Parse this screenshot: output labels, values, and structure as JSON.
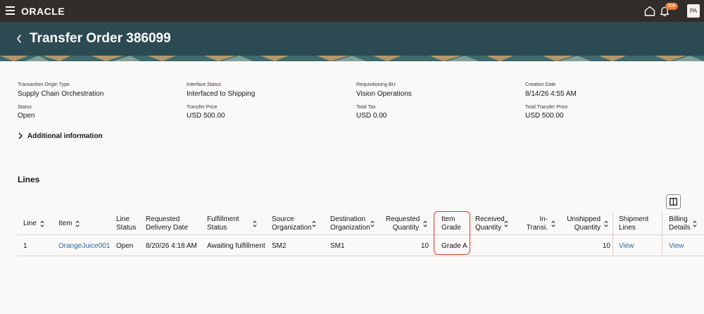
{
  "app": {
    "logo": "ORACLE",
    "notification_count": "306",
    "user_initials": "PA"
  },
  "header": {
    "title": "Transfer Order 386099"
  },
  "summary": {
    "transaction_origin_type_label": "Transaction Origin Type",
    "transaction_origin_type_value": "Supply Chain Orchestration",
    "interface_status_label": "Interface Status",
    "interface_status_value": "Interfaced to Shipping",
    "requisitioning_bu_label": "Requisitioning BU",
    "requisitioning_bu_value": "Vision Operations",
    "creation_date_label": "Creation Date",
    "creation_date_value": "8/14/26 4:55 AM",
    "status_label": "Status",
    "status_value": "Open",
    "transfer_price_label": "Transfer Price",
    "transfer_price_value": "USD 500.00",
    "total_tax_label": "Total Tax",
    "total_tax_value": "USD 0.00",
    "total_transfer_price_label": "Total Transfer Price",
    "total_transfer_price_value": "USD 500.00"
  },
  "additional_information": "Additional information",
  "lines": {
    "title": "Lines",
    "columns": {
      "line": "Line",
      "item": "Item",
      "line_status_1": "Line",
      "line_status_2": "Status",
      "req_delivery_1": "Requested",
      "req_delivery_2": "Delivery Date",
      "fulfillment_1": "Fulfillment",
      "fulfillment_2": "Status",
      "source_org_1": "Source",
      "source_org_2": "Organization",
      "dest_org_1": "Destination",
      "dest_org_2": "Organization",
      "req_qty_1": "Requested",
      "req_qty_2": "Quantity",
      "item_grade_1": "Item",
      "item_grade_2": "Grade",
      "received_qty_1": "Received",
      "received_qty_2": "Quantity",
      "in_transit_1": "In-",
      "in_transit_2": "Transi.",
      "unshipped_qty_1": "Unshipped",
      "unshipped_qty_2": "Quantity",
      "shipment_lines_1": "Shipment",
      "shipment_lines_2": "Lines",
      "billing_details_1": "Billing",
      "billing_details_2": "Details"
    },
    "rows": [
      {
        "line": "1",
        "item": "OrangeJuice001",
        "line_status": "Open",
        "requested_delivery_date": "8/20/26 4:18 AM",
        "fulfillment_status": "Awaiting fulfillment",
        "source_organization": "SM2",
        "destination_organization": "SM1",
        "requested_quantity": "10",
        "item_grade": "Grade A",
        "received_quantity": "",
        "in_transit": "",
        "unshipped_quantity": "10",
        "shipment_lines": "View",
        "billing_details": "View"
      }
    ]
  },
  "colors": {
    "topbar": "#312d2a",
    "header": "#2c4a52",
    "link": "#2b6aa0",
    "highlight": "#c9442a",
    "badge": "#e8783a"
  }
}
